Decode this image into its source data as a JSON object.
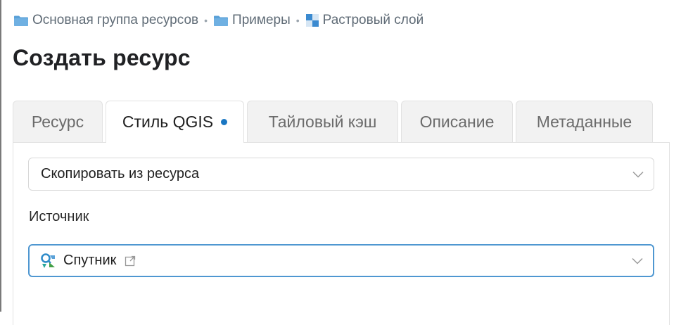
{
  "breadcrumb": {
    "items": [
      {
        "label": "Основная группа ресурсов",
        "icon": "folder-icon"
      },
      {
        "label": "Примеры",
        "icon": "folder-icon"
      },
      {
        "label": "Растровый слой",
        "icon": "raster-layer-icon"
      }
    ],
    "separator": "•"
  },
  "page": {
    "title": "Создать ресурс"
  },
  "tabs": [
    {
      "label": "Ресурс",
      "active": false
    },
    {
      "label": "Стиль QGIS",
      "active": true,
      "modified": true
    },
    {
      "label": "Тайловый кэш",
      "active": false
    },
    {
      "label": "Описание",
      "active": false
    },
    {
      "label": "Метаданные",
      "active": false
    }
  ],
  "form": {
    "mode_select": {
      "value": "Скопировать из ресурса",
      "icon": "chevron-down-icon"
    },
    "source_label": "Источник",
    "source_select": {
      "value": "Спутник",
      "icon": "qgis-style-icon",
      "link_icon": "external-link-icon"
    }
  },
  "colors": {
    "accent": "#1976c2",
    "focus_border": "#4f97d1",
    "folder": "#5aa1d8",
    "tab_inactive_bg": "#f2f2f2"
  }
}
